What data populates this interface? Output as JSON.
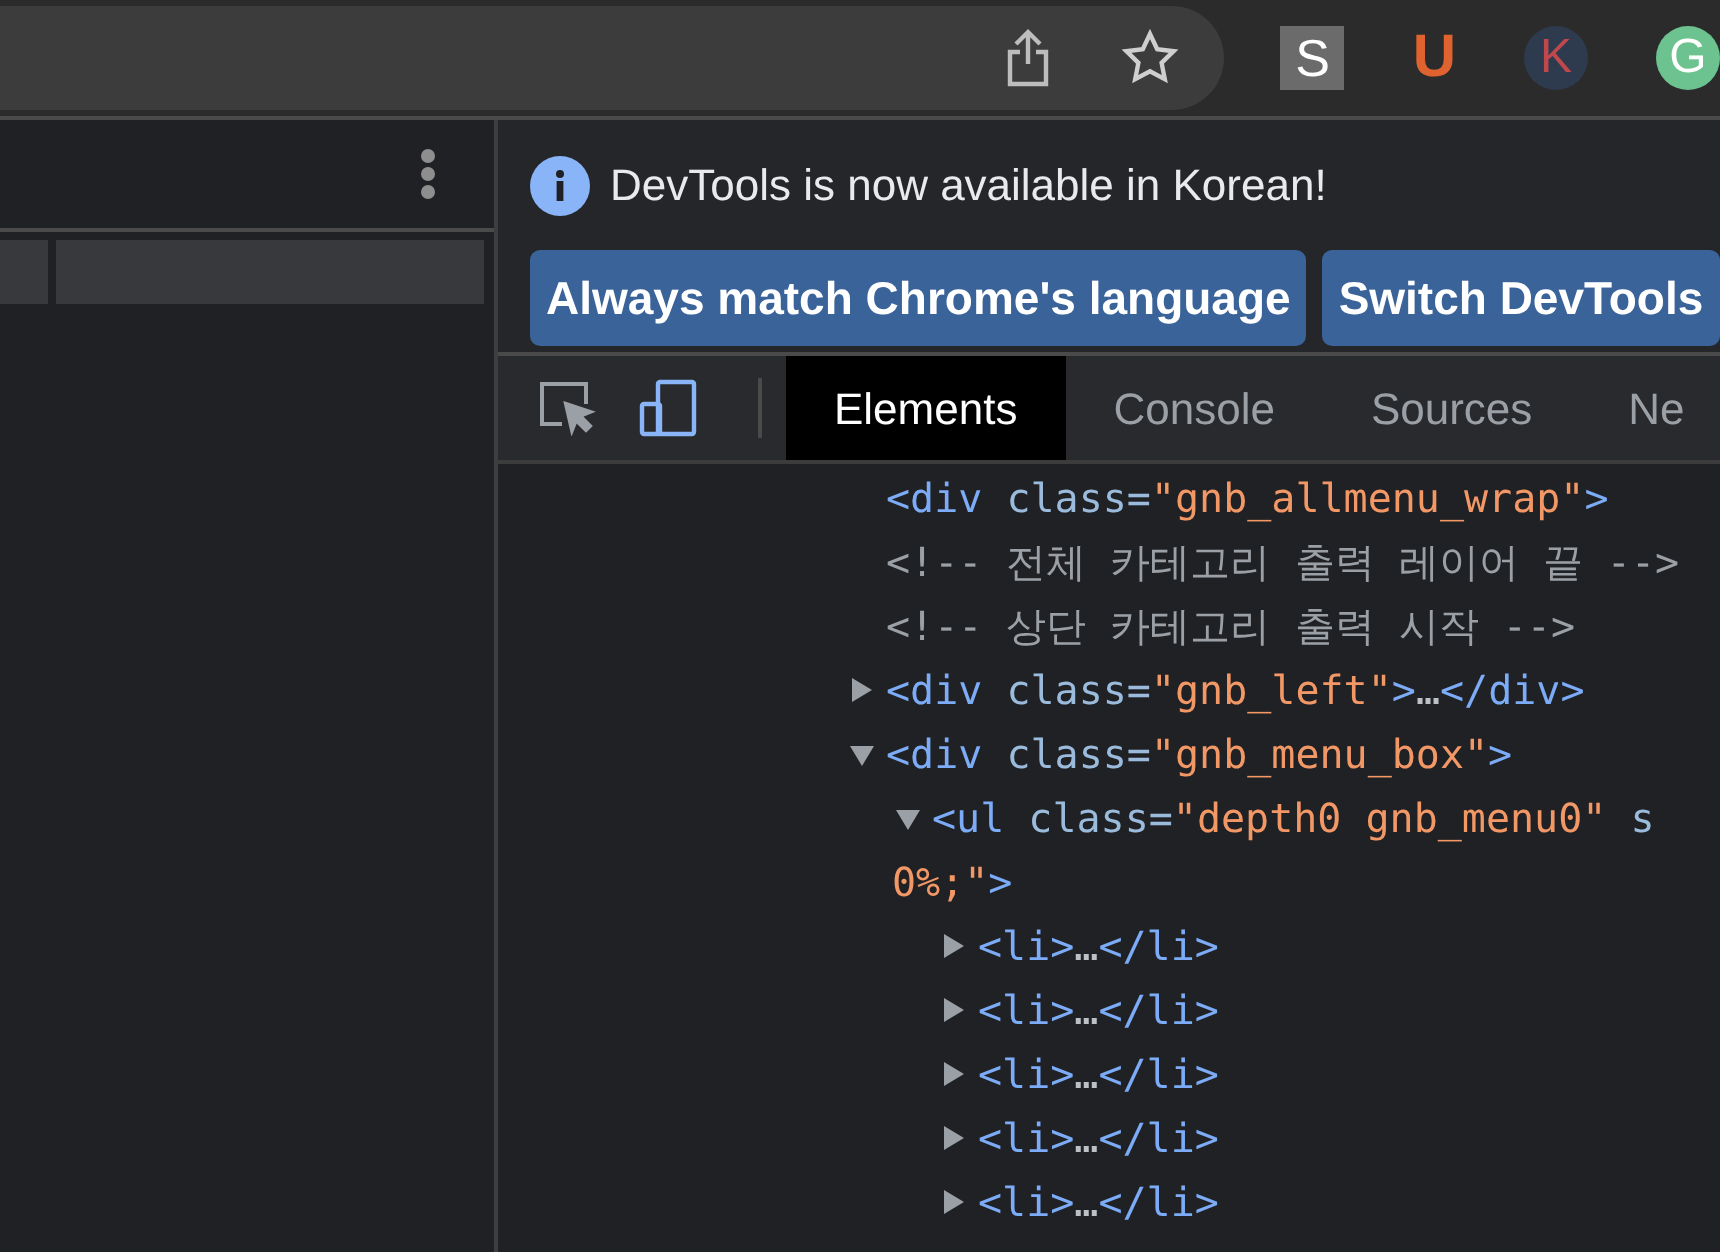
{
  "browser_toolbar": {
    "extensions": [
      {
        "kind": "square",
        "letter": "S",
        "color": "#6b6b6b"
      },
      {
        "kind": "plain",
        "letter": "U",
        "color": "#e0622e"
      },
      {
        "kind": "circle",
        "letter": "K",
        "color": "#2e3a4e"
      },
      {
        "kind": "circle",
        "letter": "G",
        "color": "#6cc38f"
      }
    ]
  },
  "devtools": {
    "infobar": {
      "message": "DevTools is now available in Korean!",
      "buttons": [
        "Always match Chrome's language",
        "Switch DevTools"
      ]
    },
    "tabs": [
      {
        "label": "Elements",
        "selected": true
      },
      {
        "label": "Console",
        "selected": false
      },
      {
        "label": "Sources",
        "selected": false
      },
      {
        "label": "Ne",
        "selected": false
      }
    ],
    "dom_tree": [
      {
        "kind": "leaf",
        "segments": [
          {
            "kind": "tag",
            "text": "<div "
          },
          {
            "kind": "attr",
            "text": "class="
          },
          {
            "kind": "value",
            "text": "\"gnb_allmenu_wrap\""
          },
          {
            "kind": "tag",
            "text": ">"
          }
        ]
      },
      {
        "kind": "leaf",
        "segments": [
          {
            "kind": "comment",
            "text": "<!-- 전체 카테고리 출력 레이어 끝 -->"
          }
        ]
      },
      {
        "kind": "leaf",
        "segments": [
          {
            "kind": "comment",
            "text": "<!-- 상단 카테고리 출력 시작 -->"
          }
        ]
      },
      {
        "kind": "parent",
        "expanded": false,
        "segments": [
          {
            "kind": "tag",
            "text": "<div "
          },
          {
            "kind": "attr",
            "text": "class="
          },
          {
            "kind": "value",
            "text": "\"gnb_left\""
          },
          {
            "kind": "tag",
            "text": ">"
          },
          {
            "kind": "ellipsis",
            "text": "…"
          },
          {
            "kind": "tag",
            "text": "</div>"
          }
        ]
      },
      {
        "kind": "parent",
        "expanded": true,
        "segments": [
          {
            "kind": "tag",
            "text": "<div "
          },
          {
            "kind": "attr",
            "text": "class="
          },
          {
            "kind": "value",
            "text": "\"gnb_menu_box\""
          },
          {
            "kind": "tag",
            "text": ">"
          }
        ],
        "children": [
          {
            "kind": "parent",
            "expanded": true,
            "segments": [
              {
                "kind": "tag",
                "text": "<ul "
              },
              {
                "kind": "attr",
                "text": "class="
              },
              {
                "kind": "value",
                "text": "\"depth0 gnb_menu0\""
              },
              {
                "kind": "attr",
                "text": " s"
              }
            ],
            "continuation": [
              {
                "kind": "value",
                "text": "0%;\""
              },
              {
                "kind": "tag",
                "text": ">"
              }
            ],
            "children": [
              {
                "kind": "parent",
                "expanded": false,
                "segments": [
                  {
                    "kind": "tag",
                    "text": "<li>"
                  },
                  {
                    "kind": "ellipsis",
                    "text": "…"
                  },
                  {
                    "kind": "tag",
                    "text": "</li>"
                  }
                ]
              },
              {
                "kind": "parent",
                "expanded": false,
                "segments": [
                  {
                    "kind": "tag",
                    "text": "<li>"
                  },
                  {
                    "kind": "ellipsis",
                    "text": "…"
                  },
                  {
                    "kind": "tag",
                    "text": "</li>"
                  }
                ]
              },
              {
                "kind": "parent",
                "expanded": false,
                "segments": [
                  {
                    "kind": "tag",
                    "text": "<li>"
                  },
                  {
                    "kind": "ellipsis",
                    "text": "…"
                  },
                  {
                    "kind": "tag",
                    "text": "</li>"
                  }
                ]
              },
              {
                "kind": "parent",
                "expanded": false,
                "segments": [
                  {
                    "kind": "tag",
                    "text": "<li>"
                  },
                  {
                    "kind": "ellipsis",
                    "text": "…"
                  },
                  {
                    "kind": "tag",
                    "text": "</li>"
                  }
                ]
              },
              {
                "kind": "parent",
                "expanded": false,
                "segments": [
                  {
                    "kind": "tag",
                    "text": "<li>"
                  },
                  {
                    "kind": "ellipsis",
                    "text": "…"
                  },
                  {
                    "kind": "tag",
                    "text": "</li>"
                  }
                ]
              }
            ]
          }
        ]
      }
    ]
  }
}
